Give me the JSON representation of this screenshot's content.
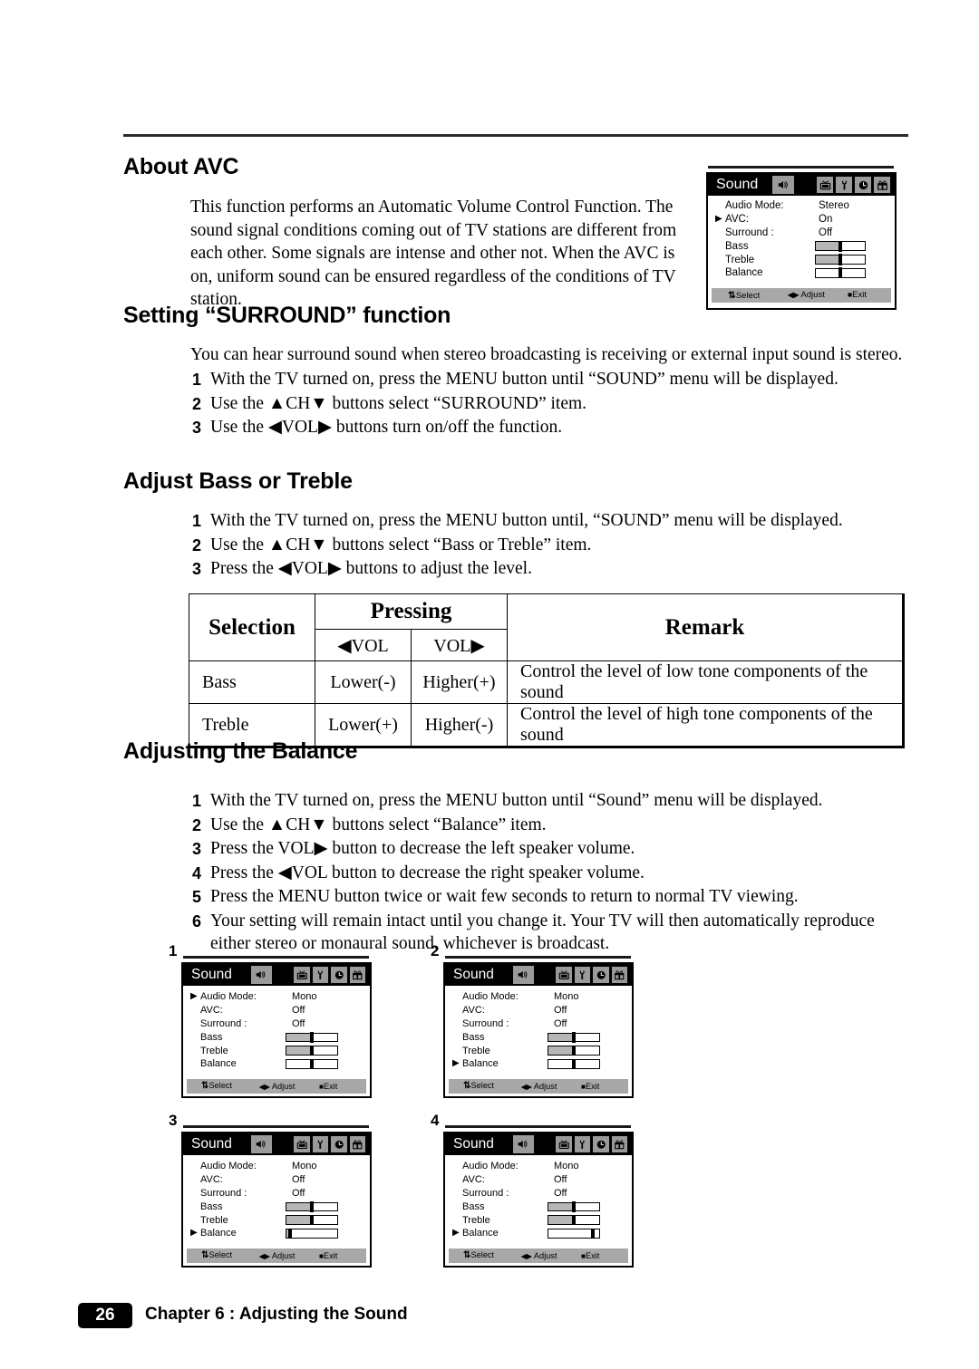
{
  "page": {
    "number": "26",
    "chapter": "Chapter 6 : Adjusting the Sound"
  },
  "sections": {
    "about_avc": {
      "heading": "About AVC",
      "body": "This function performs an Automatic Volume Control Function. The sound signal conditions coming out of TV stations are different from each other. Some signals are intense and other not. When the AVC is on, uniform sound can be ensured regardless of the conditions of TV station."
    },
    "surround": {
      "heading": "Setting “SURROUND” function",
      "intro": "You can hear surround sound when stereo broadcasting is receiving or external input sound is stereo.",
      "steps": [
        {
          "num": "1",
          "text": "With the TV turned on, press the MENU button until “SOUND” menu will be displayed."
        },
        {
          "num": "2",
          "text": "Use the ▲CH▼ buttons select “SURROUND” item."
        },
        {
          "num": "3",
          "text": "Use the ◀VOL▶ buttons turn on/off the function."
        }
      ]
    },
    "bass_treble": {
      "heading": "Adjust Bass or Treble",
      "steps": [
        {
          "num": "1",
          "text": "With the TV turned on, press the MENU button until, “SOUND” menu will be displayed."
        },
        {
          "num": "2",
          "text": "Use the ▲CH▼ buttons select “Bass or Treble” item."
        },
        {
          "num": "3",
          "text": "Press the ◀VOL▶ buttons to adjust the level."
        }
      ]
    },
    "balance": {
      "heading": "Adjusting the Balance",
      "steps": [
        {
          "num": "1",
          "text": "With the TV turned on, press the MENU button until “Sound” menu will be displayed."
        },
        {
          "num": "2",
          "text": "Use the ▲CH▼ buttons select “Balance” item."
        },
        {
          "num": "3",
          "text": "Press the VOL▶ button to decrease the left speaker volume."
        },
        {
          "num": "4",
          "text": "Press the ◀VOL button to decrease the right speaker volume."
        },
        {
          "num": "5",
          "text": "Press the MENU button twice or wait few seconds to return to normal TV viewing."
        },
        {
          "num": "6",
          "text": "Your setting will remain intact until you change it. Your TV will then automatically reproduce either stereo or monaural sound, whichever is broadcast."
        }
      ]
    }
  },
  "table": {
    "headers": {
      "selection": "Selection",
      "pressing": "Pressing",
      "vol_left": "◀VOL",
      "vol_right": "VOL▶",
      "remark": "Remark"
    },
    "rows": [
      {
        "selection": "Bass",
        "vol_left": "Lower(-)",
        "vol_right": "Higher(+)",
        "remark": "Control the level of low tone components of the sound"
      },
      {
        "selection": "Treble",
        "vol_left": "Lower(+)",
        "vol_right": "Higher(-)",
        "remark": "Control the level of high tone components of the sound"
      }
    ]
  },
  "osd_common": {
    "title": "Sound",
    "icons": [
      "speaker-icon",
      "tv-icon",
      "wrench-icon",
      "clock-icon",
      "gift-icon"
    ],
    "footer": {
      "select": "Select",
      "adjust": "Adjust",
      "exit": "Exit",
      "select_glyph": "⇅",
      "adjust_glyph": "◀▶",
      "exit_glyph": "■"
    },
    "labels": {
      "audio_mode": "Audio Mode:",
      "avc": "AVC:",
      "surround": "Surround :",
      "bass": "Bass",
      "treble": "Treble",
      "balance": "Balance"
    },
    "cursor_glyph": "▶"
  },
  "osd_screens": [
    {
      "id": "main",
      "number": "",
      "audio_mode": "Stereo",
      "avc": "On",
      "surround": "Off",
      "cursor_on": "avc",
      "bass_fill": 50,
      "bass_knob": 50,
      "treble_fill": 50,
      "treble_knob": 50,
      "balance_fill": 0,
      "balance_knob": 50
    },
    {
      "id": "step1",
      "number": "1",
      "audio_mode": "Mono",
      "avc": "Off",
      "surround": "Off",
      "cursor_on": "audio_mode",
      "bass_fill": 50,
      "bass_knob": 50,
      "treble_fill": 50,
      "treble_knob": 50,
      "balance_fill": 0,
      "balance_knob": 50
    },
    {
      "id": "step2",
      "number": "2",
      "audio_mode": "Mono",
      "avc": "Off",
      "surround": "Off",
      "cursor_on": "balance",
      "bass_fill": 50,
      "bass_knob": 50,
      "treble_fill": 50,
      "treble_knob": 50,
      "balance_fill": 0,
      "balance_knob": 50
    },
    {
      "id": "step3",
      "number": "3",
      "audio_mode": "Mono",
      "avc": "Off",
      "surround": "Off",
      "cursor_on": "balance",
      "bass_fill": 50,
      "bass_knob": 50,
      "treble_fill": 50,
      "treble_knob": 50,
      "balance_fill": 6,
      "balance_knob": 8
    },
    {
      "id": "step4",
      "number": "4",
      "audio_mode": "Mono",
      "avc": "Off",
      "surround": "Off",
      "cursor_on": "balance",
      "bass_fill": 50,
      "bass_knob": 50,
      "treble_fill": 50,
      "treble_knob": 50,
      "balance_fill": 0,
      "balance_knob": 88
    }
  ]
}
